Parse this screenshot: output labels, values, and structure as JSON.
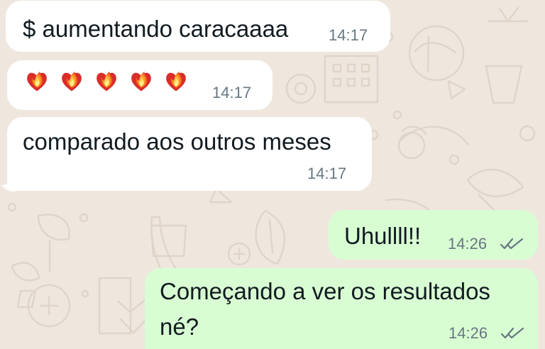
{
  "colors": {
    "wallpaper": "#efe7de",
    "incoming_bubble": "#ffffff",
    "outgoing_bubble": "#d9fdd3",
    "text": "#111b21",
    "timestamp": "#667781",
    "read_ticks": "#667781"
  },
  "messages": [
    {
      "direction": "incoming",
      "text": "$ aumentando caracaaaa",
      "time": "14:17"
    },
    {
      "direction": "incoming",
      "emoji_icons": [
        "heart-on-fire-emoji",
        "heart-on-fire-emoji",
        "heart-on-fire-emoji",
        "heart-on-fire-emoji",
        "heart-on-fire-emoji"
      ],
      "time": "14:17"
    },
    {
      "direction": "incoming",
      "text": "comparado aos outros meses",
      "time": "14:17"
    },
    {
      "direction": "outgoing",
      "text": "Uhullll!!",
      "time": "14:26",
      "status_icon": "double-check-icon"
    },
    {
      "direction": "outgoing",
      "text_lines": [
        "Começando a ver os resultados",
        "né?"
      ],
      "time": "14:26",
      "status_icon": "double-check-icon"
    }
  ]
}
